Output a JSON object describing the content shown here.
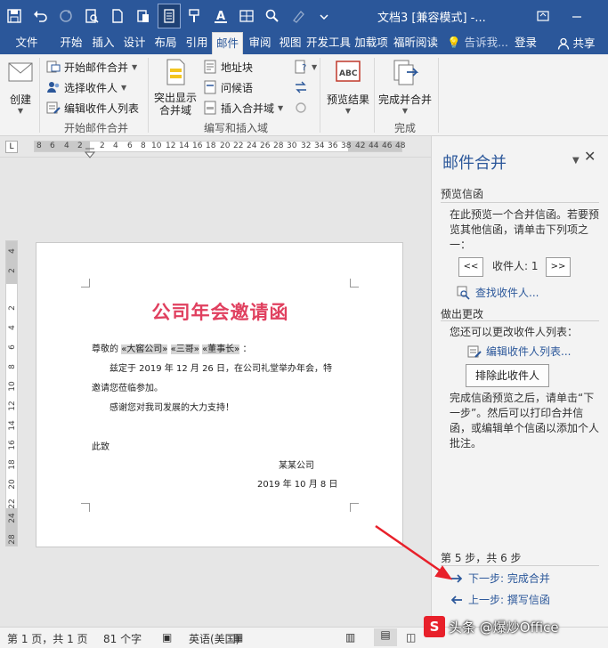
{
  "titlebar": {
    "title": "文档3 [兼容模式] -...",
    "icons": [
      "save-icon",
      "undo-icon",
      "redo-icon",
      "print-preview-icon",
      "new-doc-icon",
      "paste-icon",
      "layout-icon",
      "format-painter-icon",
      "font-color-icon",
      "table-icon",
      "find-icon",
      "highlight-icon",
      "more-icon"
    ]
  },
  "tabs": {
    "items": [
      "文件",
      "开始",
      "插入",
      "设计",
      "布局",
      "引用",
      "邮件",
      "审阅",
      "视图",
      "开发工具",
      "加载项",
      "福昕阅读"
    ],
    "active": "邮件",
    "tell_me": "告诉我...",
    "login": "登录",
    "share": "共享"
  },
  "ribbon": {
    "create": "创建",
    "start_mail_merge": "开始邮件合并",
    "select_recipients": "选择收件人",
    "edit_recipients": "编辑收件人列表",
    "group_start": "开始邮件合并",
    "highlight_fields": "突出显示\n合并域",
    "address_block": "地址块",
    "greeting_line": "问候语",
    "insert_field": "插入合并域",
    "group_write": "编写和插入域",
    "preview_results": "预览结果",
    "finish_merge": "完成并合并",
    "group_finish": "完成"
  },
  "ruler": {
    "tab_selector": "L",
    "numbers": [
      "8",
      "6",
      "4",
      "2",
      "2",
      "4",
      "6",
      "8",
      "10",
      "12",
      "14",
      "16",
      "18",
      "20",
      "22",
      "24",
      "26",
      "28",
      "30",
      "32",
      "34",
      "36",
      "38",
      "42",
      "44",
      "46",
      "48"
    ],
    "vnumbers": [
      "4",
      "2",
      "2",
      "4",
      "6",
      "8",
      "10",
      "12",
      "14",
      "16",
      "18",
      "20",
      "22",
      "24",
      "28"
    ]
  },
  "letter": {
    "title": "公司年会邀请函",
    "salutation_prefix": "尊敬的",
    "field_company": "«大窖公司»",
    "field_name": "«三哥»",
    "field_title": "«董事长»",
    "salutation_suffix": "：",
    "body1": "兹定于 2019 年 12 月 26 日，在公司礼堂举办年会，特",
    "body2": "邀请您莅临参加。",
    "body3": "感谢您对我司发展的大力支持！",
    "closing": "此致",
    "signature_company": "某某公司",
    "signature_date": "2019 年 10 月 8 日"
  },
  "pane": {
    "title": "邮件合并",
    "section_preview": "预览信函",
    "preview_text": "在此预览一个合并信函。若要预览其他信函，请单击下列项之一：",
    "prev_btn": "<<",
    "recipient_label": "收件人: 1",
    "next_btn": ">>",
    "find_recipient": "查找收件人...",
    "section_changes": "做出更改",
    "changes_text": "您还可以更改收件人列表：",
    "edit_list": "编辑收件人列表...",
    "exclude_btn": "排除此收件人",
    "complete_text": "完成信函预览之后，请单击“下一步”。然后可以打印合并信函，或编辑单个信函以添加个人批注。",
    "step": "第 5 步，共 6 步",
    "next_step": "下一步: 完成合并",
    "prev_step": "上一步: 撰写信函"
  },
  "status": {
    "page": "第 1 页，共 1 页",
    "words": "81 个字",
    "language": "英语(美国)"
  },
  "watermark": {
    "text": "头条 @爆炒Office"
  },
  "colors": {
    "accent": "#2b579a",
    "title_red": "#e0405f",
    "arrow_red": "#e8202a"
  }
}
